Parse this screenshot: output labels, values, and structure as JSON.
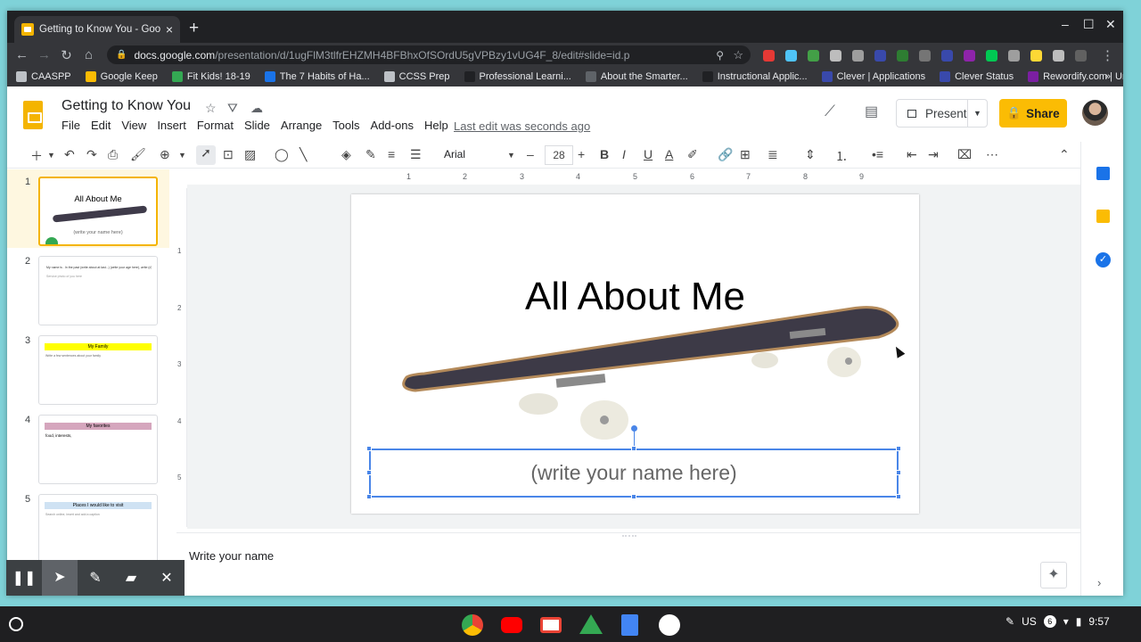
{
  "browser": {
    "tab_title": "Getting to Know You - Google Sli",
    "tab_close": "×",
    "new_tab": "+",
    "url_domain": "docs.google.com",
    "url_path": "/presentation/d/1ugFlM3tlfrEHZMH4BFBhxOfSOrdU5gVPBzy1vUG4F_8/edit#slide=id.p",
    "window_controls": [
      "–",
      "☐",
      "✕"
    ],
    "bookmarks": [
      "CAASPP",
      "Google Keep",
      "Fit Kids! 18-19",
      "The 7 Habits of Ha...",
      "CCSS Prep",
      "Professional Learni...",
      "About the Smarter...",
      "Instructional Applic...",
      "Clever | Applications",
      "Clever Status",
      "Rewordify.com | Un..."
    ],
    "bookmarks_more": "»"
  },
  "app": {
    "doc_title": "Getting to Know You",
    "menu": [
      "File",
      "Edit",
      "View",
      "Insert",
      "Format",
      "Slide",
      "Arrange",
      "Tools",
      "Add-ons",
      "Help"
    ],
    "last_edit": "Last edit was seconds ago",
    "present_label": "Present",
    "share_label": "Share"
  },
  "toolbar": {
    "font": "Arial",
    "font_size": "28",
    "minus": "–",
    "plus": "+",
    "bold": "B",
    "italic": "I",
    "underline": "U",
    "more": "⋯"
  },
  "ruler_top": [
    "1",
    "2",
    "3",
    "4",
    "5",
    "6",
    "7",
    "8",
    "9"
  ],
  "ruler_left": [
    "1",
    "2",
    "3",
    "4",
    "5"
  ],
  "slides": [
    {
      "num": "1",
      "title": "All About Me",
      "sub": "(write your name here)"
    },
    {
      "num": "2",
      "line1": "My name is . In the past (write about at last...) (write your age here), write (d)",
      "line2": "Service photo of you here"
    },
    {
      "num": "3",
      "title": "My Family",
      "body": "Write a few sentences about your family"
    },
    {
      "num": "4",
      "title": "My favorites",
      "body": "food, interests,"
    },
    {
      "num": "5",
      "title": "Places I would like to visit",
      "body": "Search online, insert and add a caption"
    }
  ],
  "slide": {
    "title": "All About Me",
    "subtitle": "(write your name here)"
  },
  "notes": "Write your name",
  "tray": {
    "locale": "US",
    "badge": "6",
    "time": "9:57"
  },
  "colors": {
    "accent": "#fbbc04",
    "selection": "#4a86e8",
    "thumb_highlight": "#fef7e0"
  }
}
